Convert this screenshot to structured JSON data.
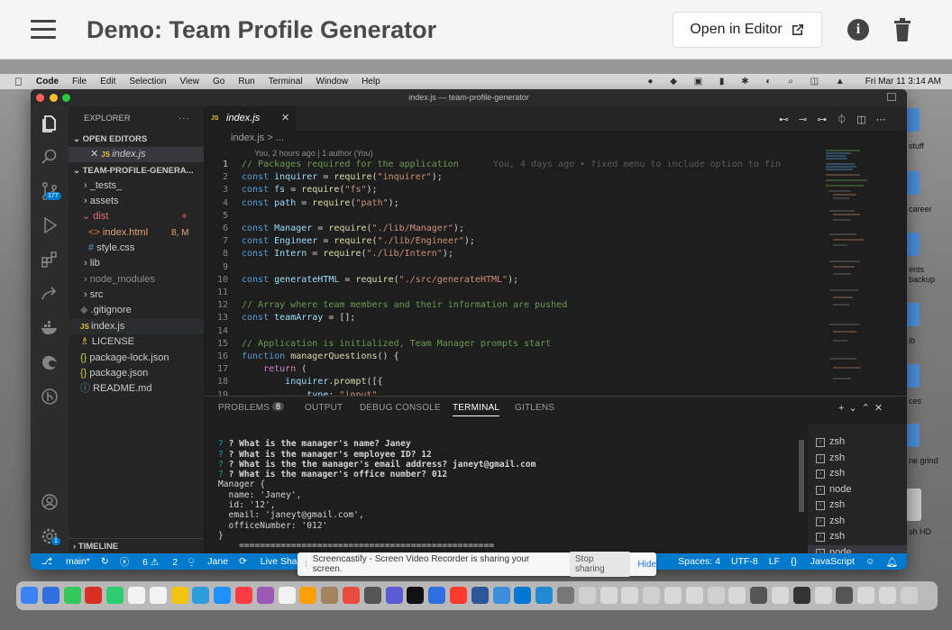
{
  "app": {
    "title": "Demo: Team Profile Generator",
    "open_in_editor": "Open in Editor"
  },
  "macos_menubar": {
    "app_name": "Code",
    "menus": [
      "File",
      "Edit",
      "Selection",
      "View",
      "Go",
      "Run",
      "Terminal",
      "Window",
      "Help"
    ],
    "clock": "Fri Mar 11  3:14 AM"
  },
  "vscode": {
    "window_title": "index.js — team-profile-generator",
    "activity_badges": {
      "source_control": "177",
      "accounts": "1"
    },
    "explorer": {
      "header": "EXPLORER",
      "open_editors_header": "OPEN EDITORS",
      "open_editor_file": "index.js",
      "project_header": "TEAM-PROFILE-GENERA...",
      "tree": [
        {
          "label": "_tests_",
          "type": "folder"
        },
        {
          "label": "assets",
          "type": "folder"
        },
        {
          "label": "dist",
          "type": "folder-open"
        },
        {
          "label": "index.html",
          "type": "html",
          "badge": "8, M"
        },
        {
          "label": "style.css",
          "type": "css"
        },
        {
          "label": "lib",
          "type": "folder"
        },
        {
          "label": "node_modules",
          "type": "folder"
        },
        {
          "label": "src",
          "type": "folder"
        },
        {
          "label": ".gitignore",
          "type": "git"
        },
        {
          "label": "index.js",
          "type": "js"
        },
        {
          "label": "LICENSE",
          "type": "license"
        },
        {
          "label": "package-lock.json",
          "type": "json"
        },
        {
          "label": "package.json",
          "type": "json"
        },
        {
          "label": "README.md",
          "type": "md"
        }
      ],
      "timeline_header": "TIMELINE"
    },
    "editor": {
      "tab_label": "index.js",
      "breadcrumb": "index.js > ...",
      "blame_header": "You, 2 hours ago | 1 author (You)",
      "inline_blame": "You, 4 days ago • fixed menu to include option to fin",
      "lines": [
        "// Packages required for the application",
        "const inquirer = require(\"inquirer\");",
        "const fs = require(\"fs\");",
        "const path = require(\"path\");",
        "",
        "const Manager = require(\"./lib/Manager\");",
        "const Engineer = require(\"./lib/Engineer\");",
        "const Intern = require(\"./lib/Intern\");",
        "",
        "const generateHTML = require(\"./src/generateHTML\");",
        "",
        "// Array where team members and their information are pushed",
        "const teamArray = [];",
        "",
        "// Application is initialized, Team Manager prompts start",
        "function managerQuestions() {",
        "    return (",
        "        inquirer.prompt([{",
        "            type: \"input\","
      ]
    },
    "panel": {
      "tabs": [
        "PROBLEMS",
        "OUTPUT",
        "DEBUG CONSOLE",
        "TERMINAL",
        "GITLENS"
      ],
      "problems_count": "8",
      "active_tab": "TERMINAL",
      "terminal_lines": [
        "? What is the manager's name? Janey",
        "? What is the manager's employee ID? 12",
        "? What is the the manager's email address? janeyt@gmail.com",
        "? What is the manager's office number? 012",
        "Manager {",
        "  name: 'Janey',",
        "  id: '12',",
        "  email: 'janeyt@gmail.com',",
        "  officeNumber: '012'",
        "}",
        "",
        "    ================================================="
      ],
      "terminal_instances": [
        "zsh",
        "zsh",
        "zsh",
        "zsh",
        "node",
        "zsh",
        "zsh",
        "zsh",
        "node"
      ]
    },
    "status_bar": {
      "branch": "main*",
      "errors": "6",
      "warnings": "2",
      "user": "Jane",
      "live_share": "Live Share",
      "spaces": "Spaces: 4",
      "encoding": "UTF-8",
      "eol": "LF",
      "language": "JavaScript"
    }
  },
  "notification": {
    "message": "Screencastify - Screen Video Recorder is sharing your screen.",
    "stop_label": "Stop sharing",
    "hide_label": "Hide"
  },
  "desktop_labels": [
    "stuff",
    "career",
    "ents",
    "backup",
    "ib",
    "ces",
    "ne grind",
    "sh HD"
  ],
  "colors": {
    "statusbar": "#007acc",
    "editor_bg": "#1e1e1e",
    "sidebar_bg": "#252526"
  }
}
